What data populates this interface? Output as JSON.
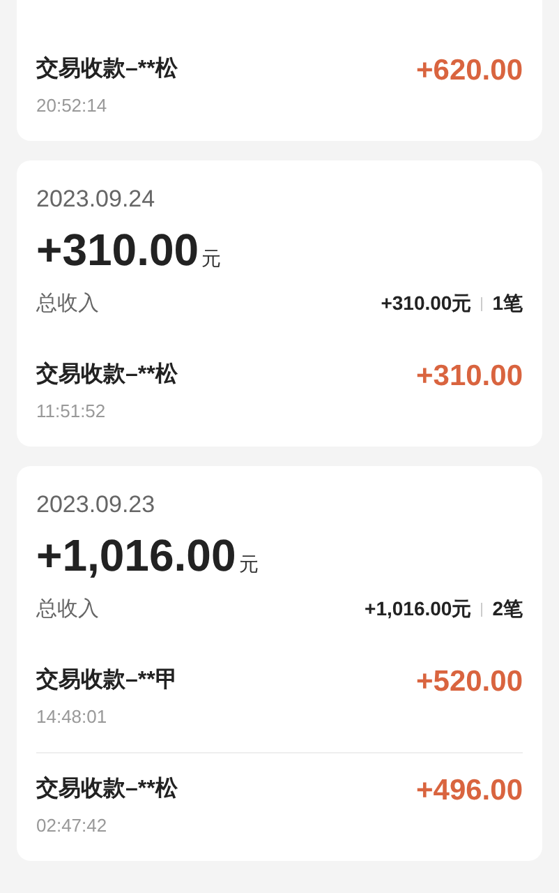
{
  "days": [
    {
      "transactions": [
        {
          "title": "交易收款–**松",
          "time": "20:52:14",
          "amount": "+620.00"
        }
      ]
    },
    {
      "date": "2023.09.24",
      "total": "+310.00",
      "unit": "元",
      "summary": {
        "label": "总收入",
        "amount": "+310.00元",
        "count": "1笔"
      },
      "transactions": [
        {
          "title": "交易收款–**松",
          "time": "11:51:52",
          "amount": "+310.00"
        }
      ]
    },
    {
      "date": "2023.09.23",
      "total": "+1,016.00",
      "unit": "元",
      "summary": {
        "label": "总收入",
        "amount": "+1,016.00元",
        "count": "2笔"
      },
      "transactions": [
        {
          "title": "交易收款–**甲",
          "time": "14:48:01",
          "amount": "+520.00"
        },
        {
          "title": "交易收款–**松",
          "time": "02:47:42",
          "amount": "+496.00"
        }
      ]
    }
  ]
}
